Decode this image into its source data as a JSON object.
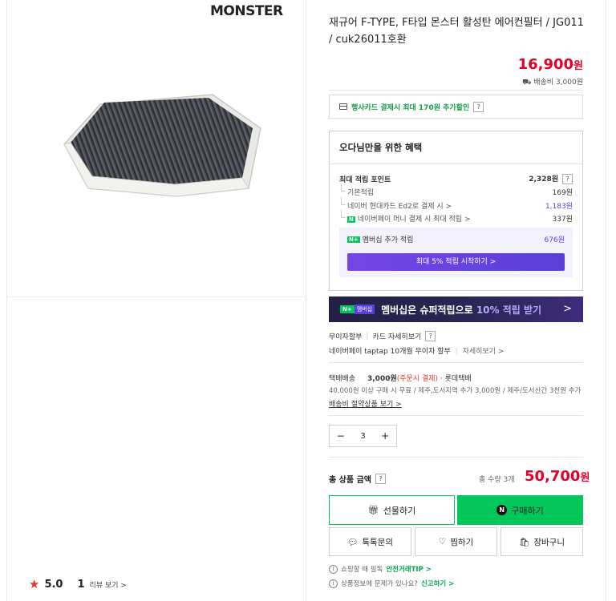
{
  "brand": {
    "logo_text": "MONSTER"
  },
  "product": {
    "title": "재규어 F-TYPE, F타입 몬스터 활성탄 에어컨필터 / JG011 / cuk26011호환",
    "price": "16,900",
    "price_unit": "원",
    "shipping_fee": "배송비 3,000원"
  },
  "rating": {
    "score": "5.0",
    "count": "1",
    "review_link": "리뷰 보기 >"
  },
  "card_promo": {
    "text": "행사카드 결제시 최대 170원 추가할인",
    "help": "?"
  },
  "benefits": {
    "heading": "오다님만을 위한 혜택",
    "max_points_label": "최대 적립 포인트",
    "max_points_value": "2,328원",
    "help": "?",
    "rows": [
      {
        "label": "기본적립",
        "value": "169원"
      },
      {
        "label": "네이버 현대카드 Ed2로 결제 시 >",
        "value": "1,183원"
      },
      {
        "label": "네이버페이 머니 결제 시 최대 적립 >",
        "value": "337원"
      }
    ],
    "npay_badge": "N",
    "membership_badge": "N+",
    "membership_label": "멤버십 추가 적립",
    "membership_value": "676원",
    "membership_button": "최대 5% 적립 시작하기 >"
  },
  "member_banner": {
    "badge_n": "N+",
    "badge_label": "멤버십",
    "text_prefix": "멤버십은 슈퍼적립으로 ",
    "text_highlight": "10% 적립 받기",
    "arrow": ">"
  },
  "installment": {
    "label": "무이자할부",
    "card_link": "카드 자세히보기",
    "help": "?",
    "taptap": "네이버페이 taptap 10개월 무이자 할부",
    "taptap_link": "자세히보기 >"
  },
  "delivery": {
    "label": "택배배송",
    "fee": "3,000원",
    "fee_note": "(주문시 결제)",
    "carrier": "· 롯데택배",
    "condition": "40,000원 이상 구매 시 무료 / 제주,도서지역 추가 3,000원 / 제주/도서산간 3천원 추가",
    "saving_link": "배송비 절약상품 보기 >"
  },
  "quantity": {
    "minus": "−",
    "value": "3",
    "plus": "+"
  },
  "total": {
    "label": "총 상품 금액",
    "help": "?",
    "count": "총 수량 3개",
    "price": "50,700",
    "unit": "원"
  },
  "buttons": {
    "gift": "선물하기",
    "buy": "구매하기",
    "buy_icon": "N",
    "talk": "톡톡문의",
    "wish": "찜하기",
    "cart": "장바구니"
  },
  "notes": [
    {
      "prefix": "쇼핑할 때 필독",
      "link": "안전거래TIP >"
    },
    {
      "prefix": "상품정보에 문제가 있나요?",
      "link": "신고하기 >"
    }
  ]
}
